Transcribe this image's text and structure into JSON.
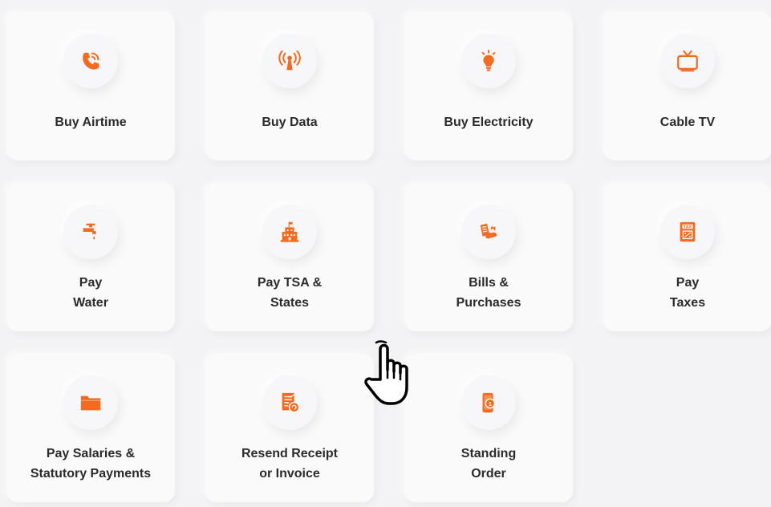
{
  "accent_color": "#f36b21",
  "services": [
    {
      "icon": "phone-icon",
      "lines": [
        "Buy Airtime"
      ]
    },
    {
      "icon": "broadcast-antenna-icon",
      "lines": [
        "Buy Data"
      ]
    },
    {
      "icon": "lightbulb-icon",
      "lines": [
        "Buy Electricity"
      ]
    },
    {
      "icon": "tv-icon",
      "lines": [
        "Cable TV"
      ]
    },
    {
      "icon": "water-tap-icon",
      "lines": [
        "Pay",
        "Water"
      ]
    },
    {
      "icon": "government-building-icon",
      "lines": [
        "Pay TSA &",
        "States"
      ]
    },
    {
      "icon": "bill-hand-icon",
      "lines": [
        "Bills &",
        "Purchases"
      ]
    },
    {
      "icon": "tax-document-icon",
      "lines": [
        "Pay",
        "Taxes"
      ]
    },
    {
      "icon": "folder-icon",
      "lines": [
        "Pay Salaries &",
        "Statutory Payments"
      ]
    },
    {
      "icon": "receipt-icon",
      "lines": [
        "Resend Receipt",
        "or Invoice"
      ]
    },
    {
      "icon": "mobile-order-icon",
      "lines": [
        "Standing",
        "Order"
      ]
    }
  ],
  "cursor": {
    "icon": "hand-pointer-icon"
  }
}
